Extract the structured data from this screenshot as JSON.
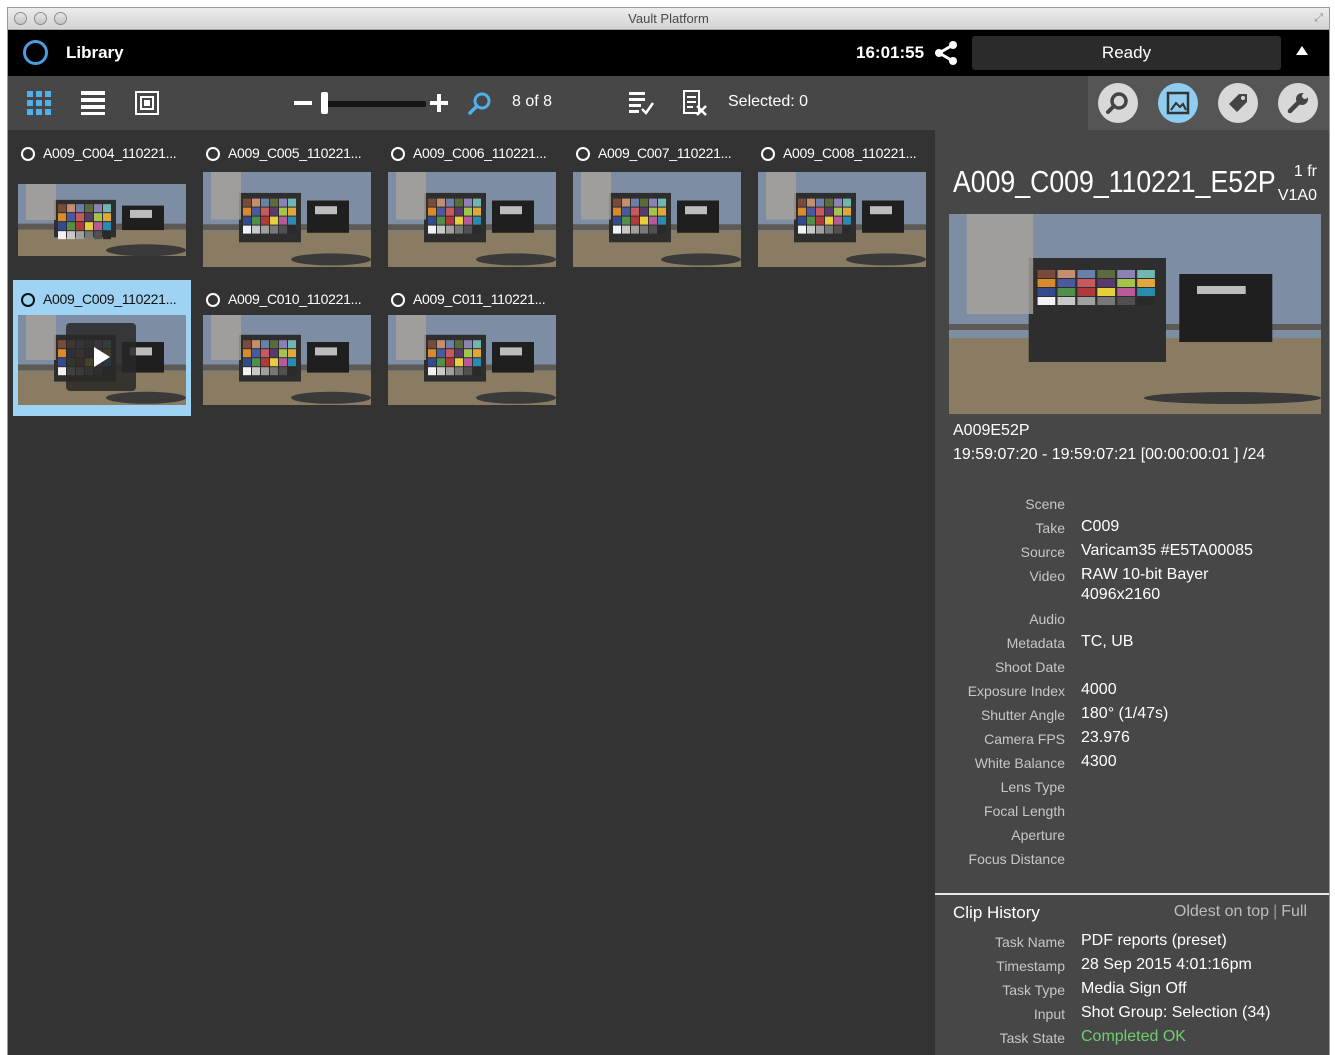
{
  "window": {
    "title": "Vault Platform"
  },
  "topbar": {
    "section": "Library",
    "clock": "16:01:55",
    "status": "Ready"
  },
  "toolbar": {
    "count": "8 of 8",
    "selected": "Selected: 0"
  },
  "clips": [
    {
      "name": "A009_C004_110221...",
      "selected": false
    },
    {
      "name": "A009_C005_110221...",
      "selected": false
    },
    {
      "name": "A009_C006_110221...",
      "selected": false
    },
    {
      "name": "A009_C007_110221...",
      "selected": false
    },
    {
      "name": "A009_C008_110221...",
      "selected": false
    },
    {
      "name": "A009_C009_110221...",
      "selected": true
    },
    {
      "name": "A009_C010_110221...",
      "selected": false
    },
    {
      "name": "A009_C011_110221...",
      "selected": false
    }
  ],
  "inspector": {
    "title": "A009_C009_110221_E52P",
    "frames": "1 fr",
    "tracks": "V1A0",
    "reel": "A009E52P",
    "timecode": "19:59:07:20  - 19:59:07:21 [00:00:00:01 ] /24",
    "metadata": [
      {
        "key": "Scene",
        "value": ""
      },
      {
        "key": "Take",
        "value": "C009"
      },
      {
        "key": "Source",
        "value": "Varicam35 #E5TA00085"
      },
      {
        "key": "Video",
        "value": "RAW 10-bit Bayer",
        "value2": "4096x2160"
      },
      {
        "key": "Audio",
        "value": ""
      },
      {
        "key": "Metadata",
        "value": "TC, UB"
      },
      {
        "key": "Shoot Date",
        "value": ""
      },
      {
        "key": "Exposure Index",
        "value": "4000"
      },
      {
        "key": "Shutter Angle",
        "value": "180° (1/47s)"
      },
      {
        "key": "Camera FPS",
        "value": "23.976"
      },
      {
        "key": "White Balance",
        "value": "4300"
      },
      {
        "key": "Lens Type",
        "value": ""
      },
      {
        "key": "Focal Length",
        "value": ""
      },
      {
        "key": "Aperture",
        "value": ""
      },
      {
        "key": "Focus Distance",
        "value": ""
      }
    ],
    "history": {
      "title": "Clip History",
      "order": "Oldest on top",
      "mode": "Full",
      "rows": [
        {
          "key": "Task Name",
          "value": "PDF reports (preset)"
        },
        {
          "key": "Timestamp",
          "value": "28 Sep 2015 4:01:16pm"
        },
        {
          "key": "Task Type",
          "value": "Media Sign Off"
        },
        {
          "key": "Input",
          "value": "Shot Group: Selection (34)"
        },
        {
          "key": "Task State",
          "value": "Completed OK",
          "status_color": "#6ecf6e"
        }
      ]
    }
  },
  "colors": {
    "accent": "#8ecdf0",
    "logo": "#4d9be0",
    "ok": "#6ecf6e"
  }
}
